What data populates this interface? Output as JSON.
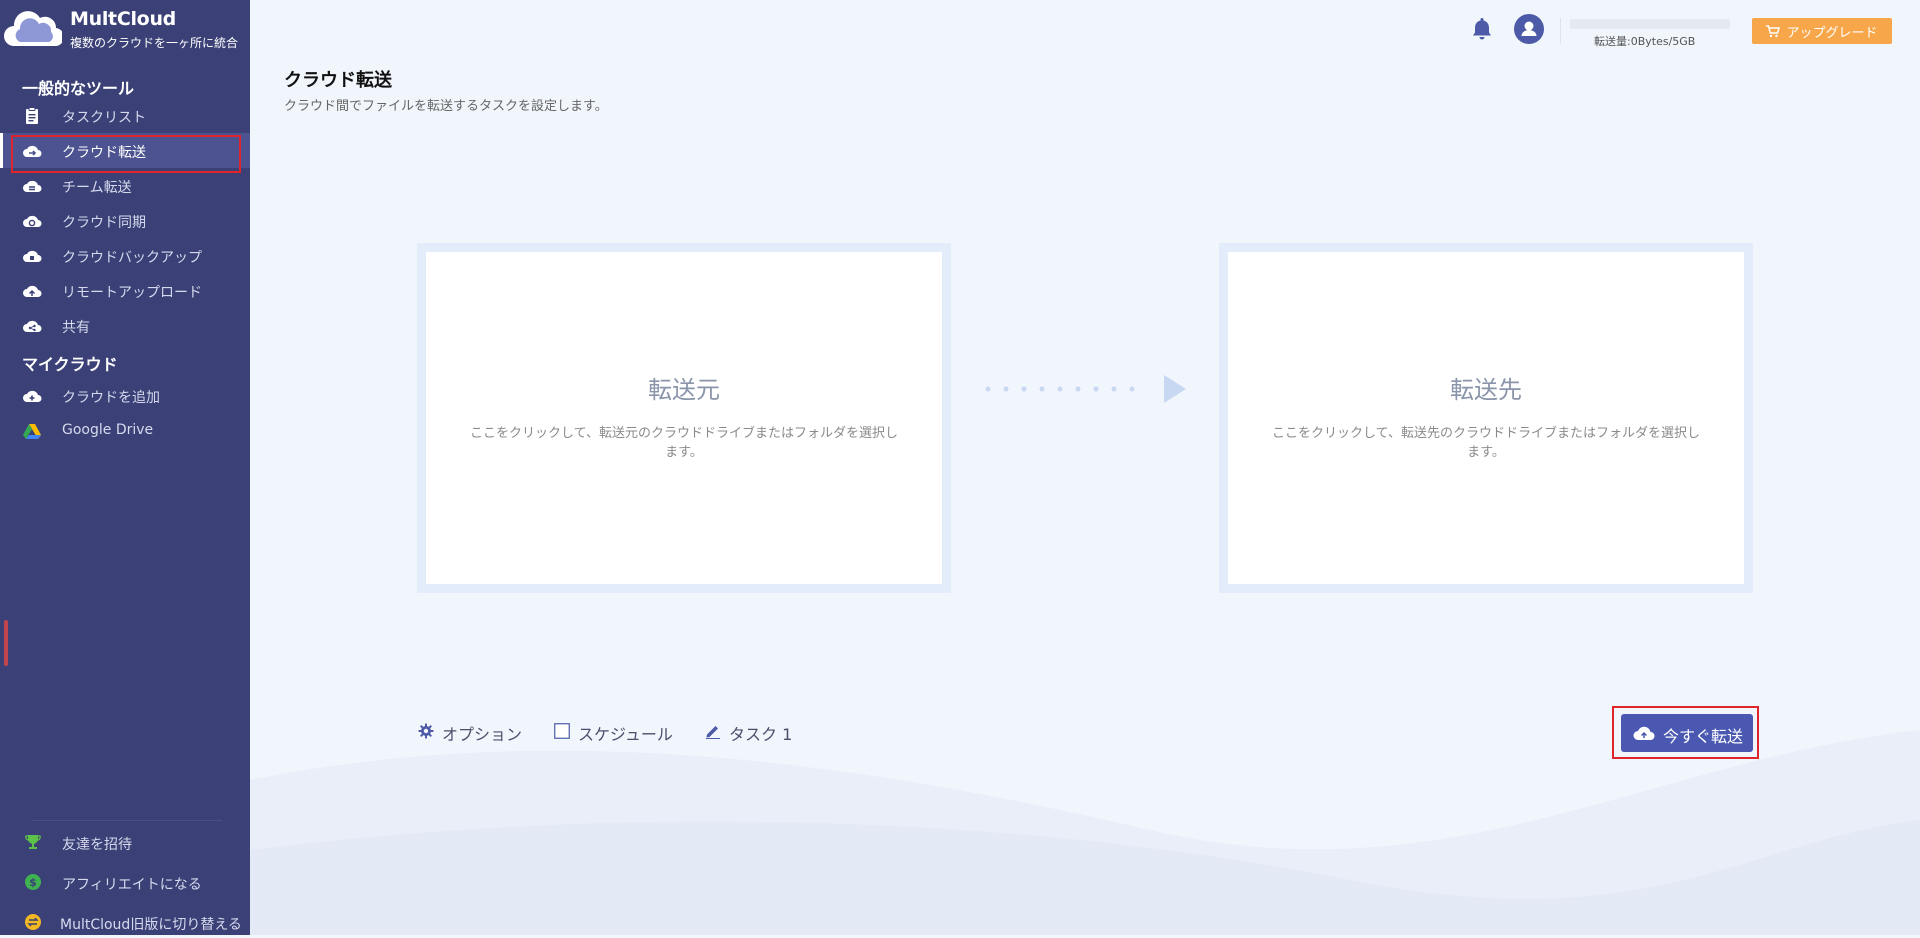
{
  "app": {
    "name": "MultCloud",
    "tagline": "複数のクラウドを一ヶ所に統合"
  },
  "sidebar": {
    "general_tools_title": "一般的なツール",
    "general_items": [
      {
        "label": "タスクリスト",
        "icon": "clipboard-icon"
      },
      {
        "label": "クラウド転送",
        "icon": "cloud-transfer-icon",
        "active": true
      },
      {
        "label": "チーム転送",
        "icon": "team-transfer-icon"
      },
      {
        "label": "クラウド同期",
        "icon": "cloud-sync-icon"
      },
      {
        "label": "クラウドバックアップ",
        "icon": "cloud-backup-icon"
      },
      {
        "label": "リモートアップロード",
        "icon": "remote-upload-icon"
      },
      {
        "label": "共有",
        "icon": "share-icon"
      }
    ],
    "my_clouds_title": "マイクラウド",
    "cloud_items": [
      {
        "label": "クラウドを追加",
        "icon": "add-cloud-icon"
      },
      {
        "label": "Google Drive",
        "icon": "google-drive-icon"
      }
    ],
    "bottom_items": [
      {
        "label": "友達を招待",
        "icon": "trophy-icon"
      },
      {
        "label": "アフィリエイトになる",
        "icon": "dollar-icon"
      },
      {
        "label": "MultCloud旧版に切り替える",
        "icon": "switch-icon"
      }
    ]
  },
  "header": {
    "quota_text": "転送量:0Bytes/5GB",
    "upgrade_label": "アップグレード"
  },
  "main": {
    "title": "クラウド転送",
    "subtitle": "クラウド間でファイルを転送するタスクを設定します。",
    "source": {
      "title": "転送元",
      "description": "ここをクリックして、転送元のクラウドドライブまたはフォルダを選択します。"
    },
    "destination": {
      "title": "転送先",
      "description": "ここをクリックして、転送先のクラウドドライブまたはフォルダを選択します。"
    },
    "options_label": "オプション",
    "schedule_label": "スケジュール",
    "task_name": "タスク 1",
    "transfer_button": "今すぐ転送"
  },
  "colors": {
    "sidebar_bg": "#3b4176",
    "accent": "#4a58b2",
    "upgrade": "#f7a74a",
    "highlight_box": "#e0242c"
  }
}
